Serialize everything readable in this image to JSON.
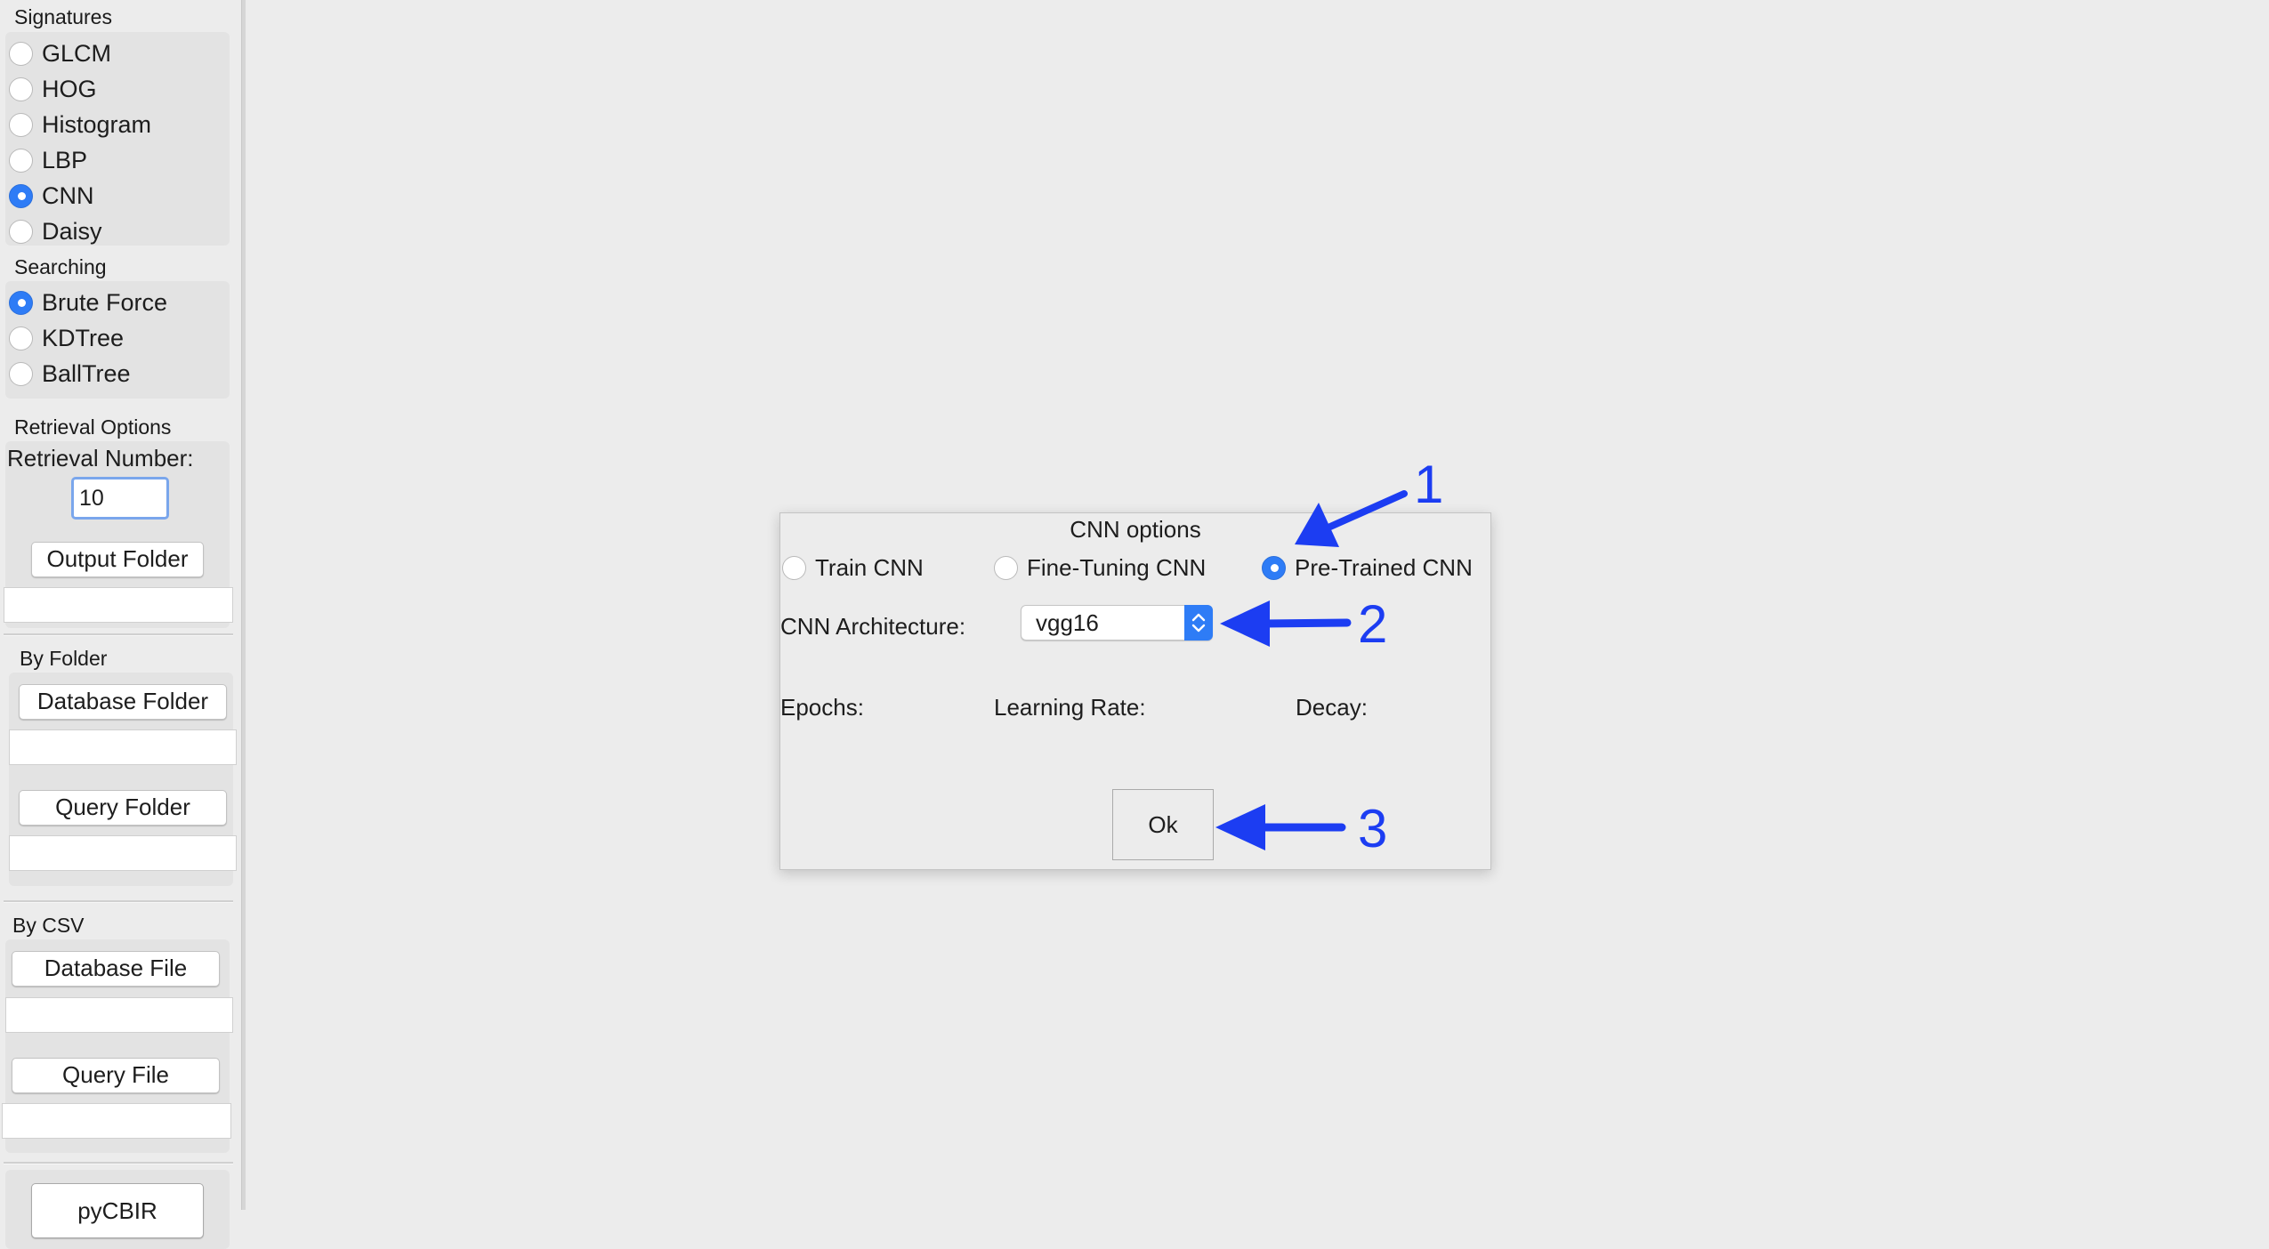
{
  "sidebar": {
    "signatures": {
      "title": "Signatures",
      "options": [
        "GLCM",
        "HOG",
        "Histogram",
        "LBP",
        "CNN",
        "Daisy"
      ],
      "selected": "CNN"
    },
    "searching": {
      "title": "Searching",
      "options": [
        "Brute Force",
        "KDTree",
        "BallTree"
      ],
      "selected": "Brute Force"
    },
    "retrieval": {
      "title": "Retrieval Options",
      "number_label": "Retrieval Number:",
      "number_value": "10",
      "output_folder_button": "Output Folder",
      "output_folder_value": ""
    },
    "by_folder": {
      "title": "By Folder",
      "database_button": "Database Folder",
      "database_value": "",
      "query_button": "Query Folder",
      "query_value": ""
    },
    "by_csv": {
      "title": "By CSV",
      "database_button": "Database File",
      "database_value": "",
      "query_button": "Query File",
      "query_value": ""
    },
    "run_button": "pyCBIR"
  },
  "dialog": {
    "title": "CNN options",
    "modes": [
      "Train CNN",
      "Fine-Tuning CNN",
      "Pre-Trained CNN"
    ],
    "selected_mode": "Pre-Trained CNN",
    "architecture_label": "CNN Architecture:",
    "architecture_value": "vgg16",
    "epochs_label": "Epochs:",
    "learning_rate_label": "Learning Rate:",
    "decay_label": "Decay:",
    "ok_button": "Ok"
  },
  "annotations": [
    "1",
    "2",
    "3"
  ],
  "colors": {
    "accent": "#2e7cf6",
    "annotation": "#1c3df2",
    "background": "#ececec"
  }
}
